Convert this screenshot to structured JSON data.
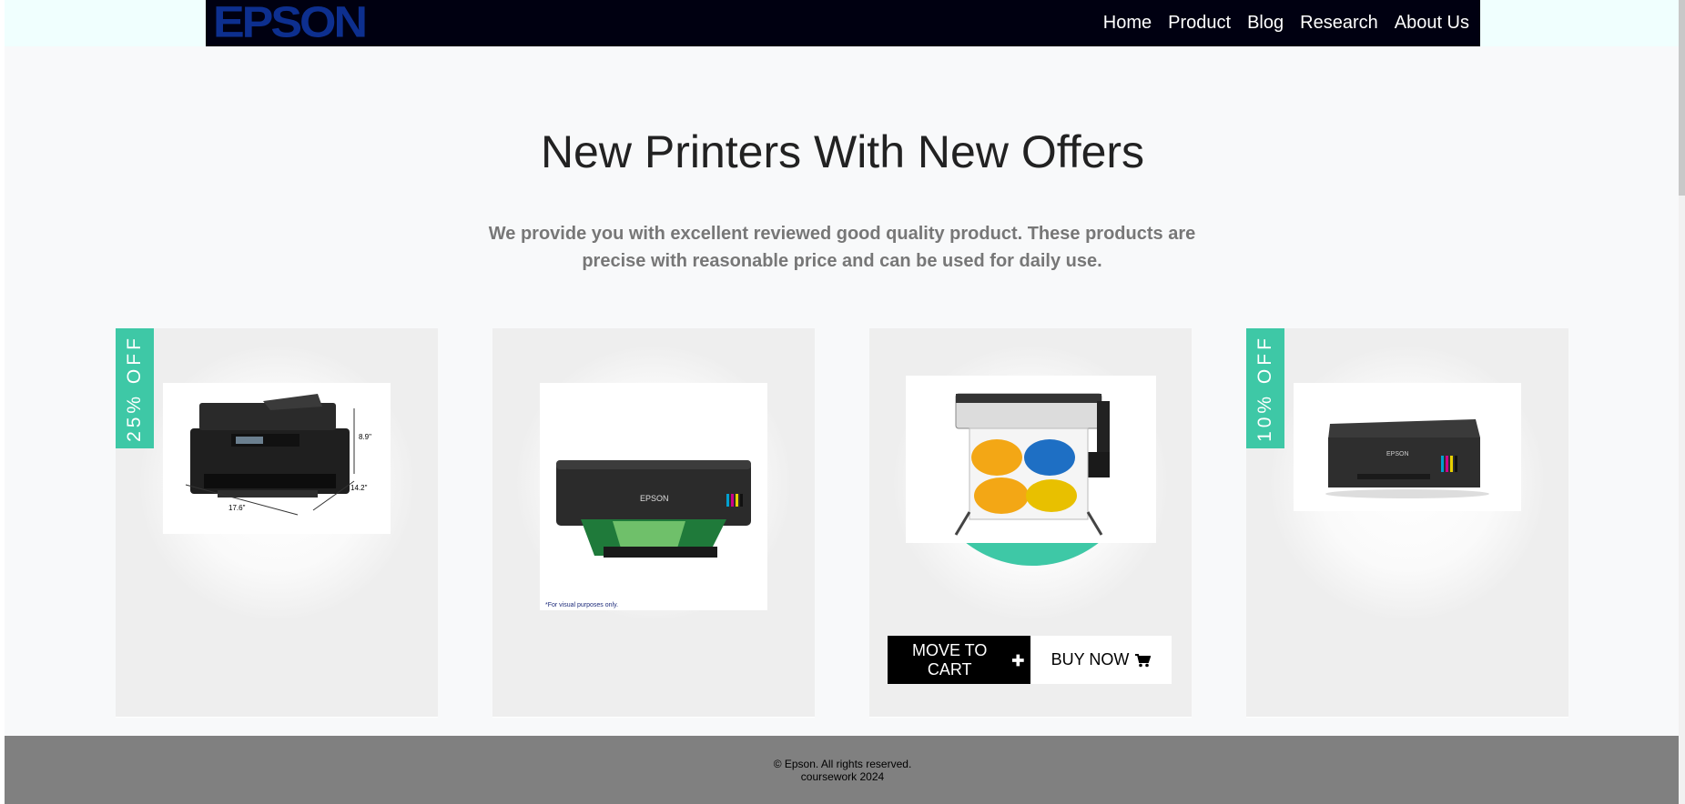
{
  "brand": {
    "logo_text": "EPSON",
    "logo_color": "#0d2f8f"
  },
  "nav": {
    "items": [
      {
        "label": "Home"
      },
      {
        "label": "Product"
      },
      {
        "label": "Blog"
      },
      {
        "label": "Research"
      },
      {
        "label": "About Us"
      }
    ]
  },
  "hero": {
    "title": "New Printers With New Offers",
    "description": "We provide you with excellent reviewed good quality product. These products are precise with reasonable price and can be used for daily use."
  },
  "products": [
    {
      "badge": "25% OFF",
      "image": "all-in-one-printer-dimensions",
      "dimensions": {
        "width": "17.6\"",
        "height": "8.9\"",
        "depth": "14.2\""
      }
    },
    {
      "badge": "",
      "image": "photo-printer-ecotank",
      "brand_on_device": "EPSON",
      "caption": "*For visual purposes only."
    },
    {
      "badge": "",
      "image": "large-format-printer",
      "hovered": true,
      "move_to_cart_label": "MOVE TO CART",
      "buy_now_label": "BUY NOW"
    },
    {
      "badge": "10% OFF",
      "image": "compact-ecotank-printer",
      "brand_on_device": "EPSON"
    }
  ],
  "footer": {
    "copyright": "© Epson. All rights reserved.",
    "note": "coursework 2024"
  },
  "colors": {
    "accent": "#3ec8a6",
    "navbar": "#000011",
    "footer": "#808080"
  }
}
